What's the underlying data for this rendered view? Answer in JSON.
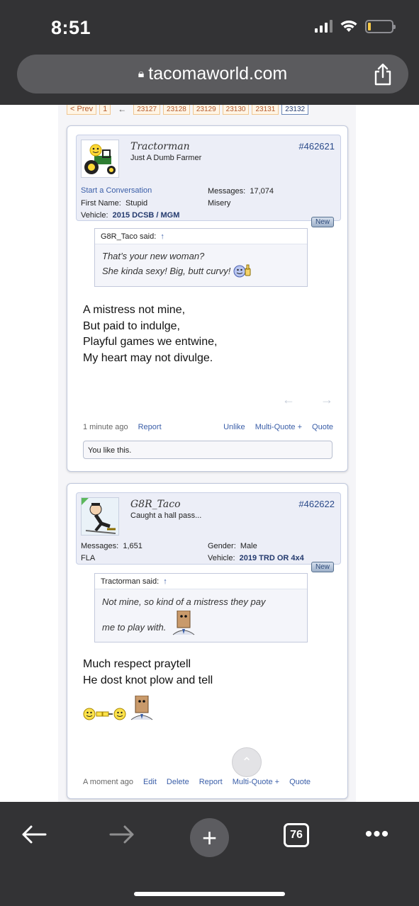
{
  "status": {
    "time": "8:51"
  },
  "browser": {
    "url": "tacomaworld.com",
    "tab_count": "76"
  },
  "pagination": {
    "prev": "< Prev",
    "first": "1",
    "arrow": "←",
    "pages": [
      "23127",
      "23128",
      "23129",
      "23130",
      "23131"
    ],
    "current": "23132"
  },
  "posts": [
    {
      "username": "Tractorman",
      "user_title": "Just A Dumb Farmer",
      "post_number": "#462621",
      "start_conversation": "Start a Conversation",
      "first_name_label": "First Name:",
      "first_name": "Stupid",
      "vehicle_label": "Vehicle:",
      "vehicle": "2015 DCSB / MGM",
      "messages_label": "Messages:",
      "messages": "17,074",
      "location": "Misery",
      "badge": "New",
      "quote_author": "G8R_Taco said:",
      "quote_arrow": "↑",
      "quote_line1": "That’s your new woman?",
      "quote_line2": "She kinda sexy! Big, butt curvy!",
      "message_lines": [
        "A mistress not mine,",
        "But paid to indulge,",
        "Playful games we entwine,",
        "My heart may not divulge."
      ],
      "time_ago": "1 minute ago",
      "report": "Report",
      "unlike": "Unlike",
      "multi_quote": "Multi-Quote +",
      "quote": "Quote",
      "likes_text": "You like this."
    },
    {
      "username": "G8R_Taco",
      "user_title": "Caught a hall pass...",
      "post_number": "#462622",
      "messages_label": "Messages:",
      "messages": "1,651",
      "location": "FLA",
      "gender_label": "Gender:",
      "gender": "Male",
      "vehicle_label": "Vehicle:",
      "vehicle": "2019 TRD OR 4x4",
      "badge": "New",
      "quote_author": "Tractorman said:",
      "quote_arrow": "↑",
      "quote_line1": "Not mine, so kind of a mistress they pay",
      "quote_line2": "me to play with.",
      "message_lines": [
        "Much respect praytell",
        "He dost knot plow and tell"
      ],
      "time_ago": "A moment ago",
      "edit": "Edit",
      "delete": "Delete",
      "report": "Report",
      "multi_quote": "Multi-Quote +",
      "quote": "Quote"
    }
  ],
  "colors": {
    "link": "#3a5ea8",
    "panel": "#eceef7",
    "chrome": "#333335"
  }
}
